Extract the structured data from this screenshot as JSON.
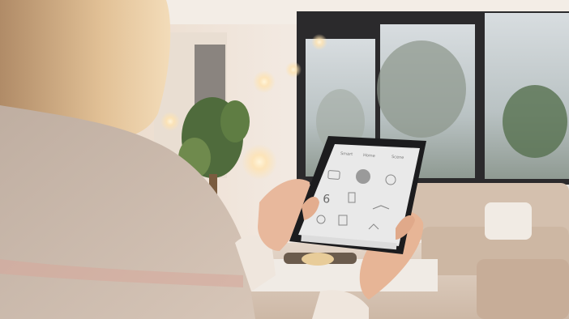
{
  "photo": {
    "subject": "person-holding-tablet-smart-home",
    "palette": {
      "wall": "#efe6dc",
      "window_frame": "#2b2a2c",
      "sofa": "#d8c5b5",
      "sweater": "#c9b8ab",
      "hair": "#dcb488",
      "tablet_screen": "#e9e9e9",
      "tablet_bezel": "#1c1c1e",
      "lamp_glow": "#ffe3b0"
    }
  },
  "tablet": {
    "header": [
      "Smart",
      "Home",
      "Scene"
    ],
    "big_number": "6",
    "icons": [
      "wifi-icon",
      "chat-bubble-icon",
      "bulb-icon",
      "thermostat-icon",
      "fan-icon",
      "lock-icon",
      "timer-icon",
      "share-icon"
    ]
  }
}
